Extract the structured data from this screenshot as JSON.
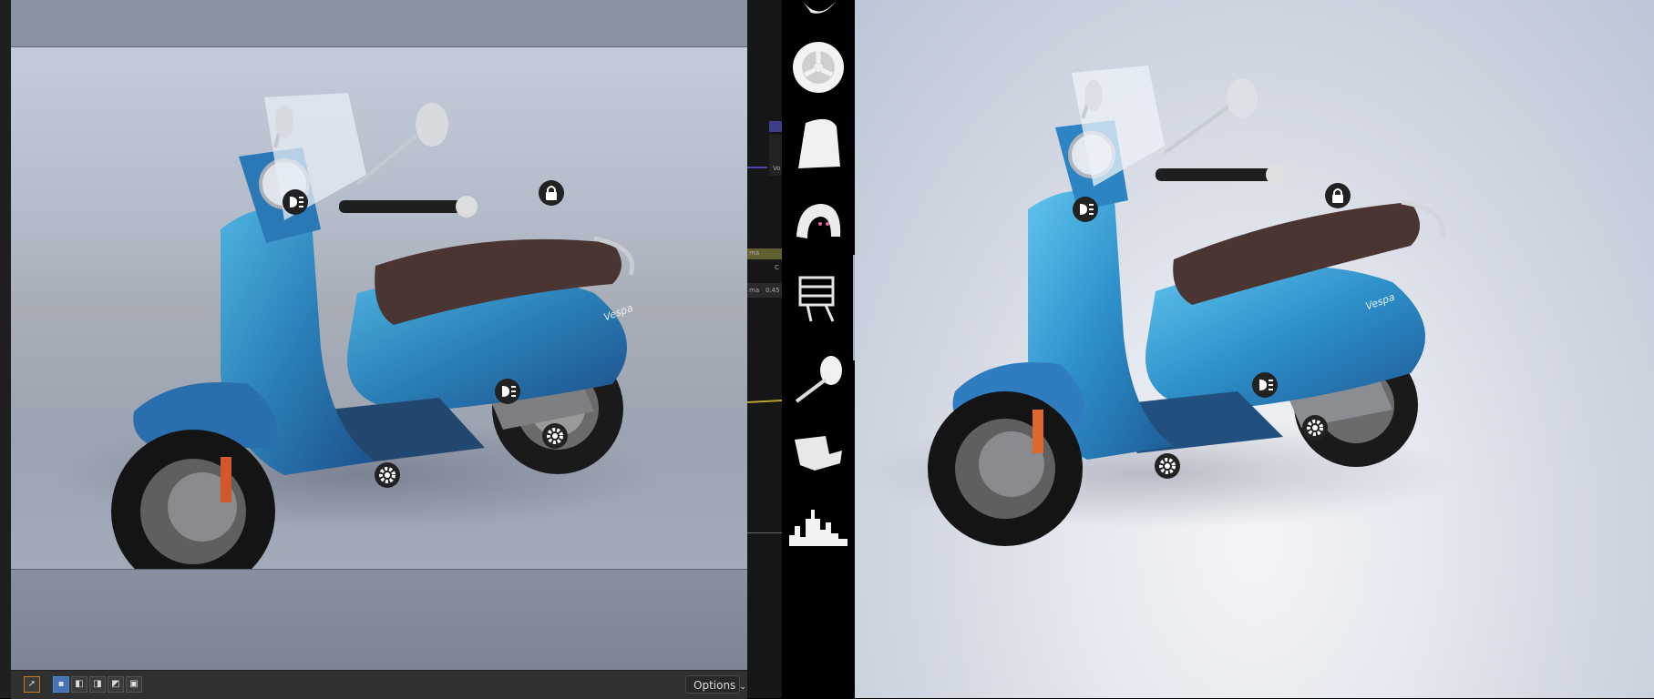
{
  "viewport": {
    "background_color": "#8993a2",
    "camera_frame_color": "#b3bac7"
  },
  "toolbar": {
    "select_tool_icon": "cursor-arrow-icon",
    "selection_modes": [
      "new",
      "extend",
      "subtract",
      "invert",
      "intersect"
    ],
    "options_label": "Options"
  },
  "panel_strip": {
    "labels": [
      "Vo",
      "ma",
      "C",
      "ma",
      "0.45"
    ]
  },
  "gallery": {
    "items": [
      "mudguard-icon",
      "wheel-rim-icon",
      "seat-cover-icon",
      "seat-back-icon",
      "rear-rack-icon",
      "mirror-icon",
      "floor-mat-icon",
      "city-skyline-icon"
    ]
  },
  "collapse_button": {
    "label": "«"
  },
  "scene": {
    "vehicle": "scooter",
    "body_color": "#2d8fc9",
    "seat_color": "#4a3532",
    "hotspots": [
      "lock-icon",
      "headlight-icon",
      "gear-icon"
    ]
  },
  "left_scooter_badge": "Vespa",
  "right_scooter_badge": "Vespa"
}
